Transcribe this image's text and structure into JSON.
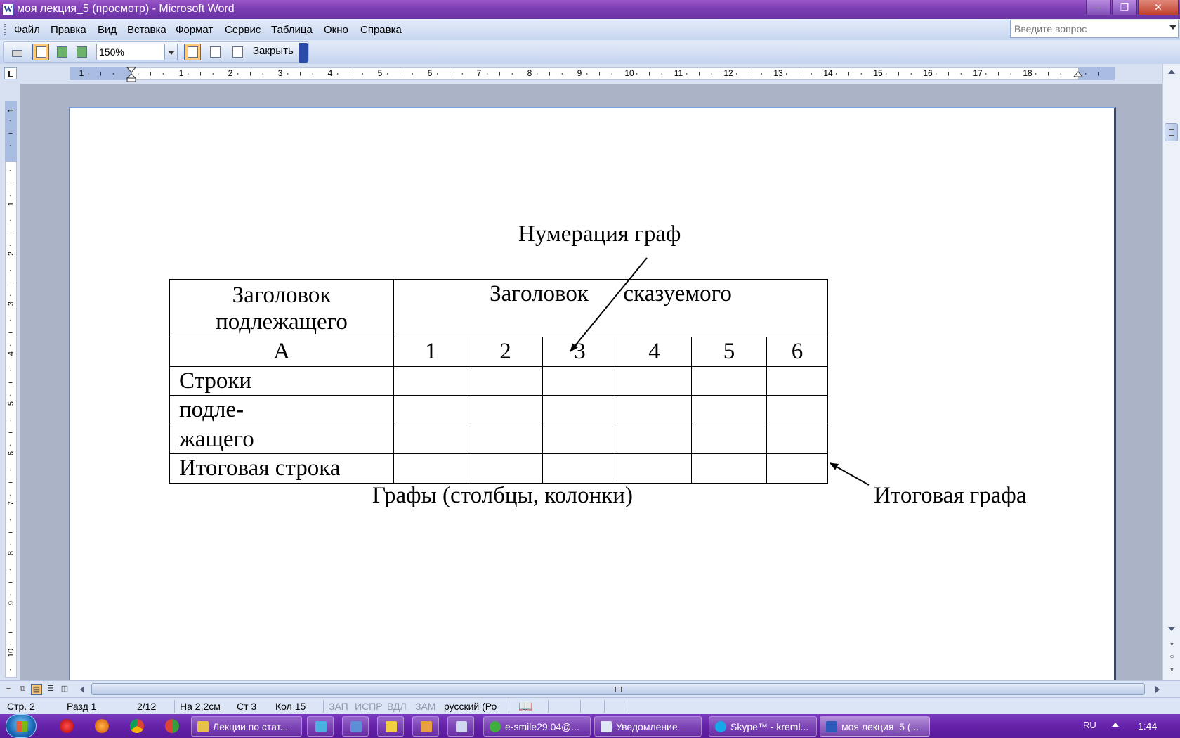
{
  "window": {
    "title": "моя лекция_5 (просмотр) - Microsoft Word",
    "minimize": "–",
    "restore": "❐",
    "close": "✕"
  },
  "menu": {
    "items": [
      "Файл",
      "Правка",
      "Вид",
      "Вставка",
      "Формат",
      "Сервис",
      "Таблица",
      "Окно",
      "Справка"
    ],
    "help_placeholder": "Введите вопрос"
  },
  "toolbar": {
    "zoom_value": "150%",
    "close_label": "Закрыть"
  },
  "ruler": {
    "h_numbers": [
      "1",
      "1",
      "2",
      "3",
      "4",
      "5",
      "6",
      "7",
      "8",
      "9",
      "10",
      "11",
      "12",
      "13",
      "14",
      "15",
      "16",
      "17",
      "18"
    ],
    "v_numbers": [
      "1",
      "1",
      "2",
      "3",
      "4",
      "5",
      "6",
      "7",
      "8",
      "9",
      "10"
    ]
  },
  "figure": {
    "numbering_label": "Нумерация граф",
    "columns_label": "Графы (столбцы, колонки)",
    "total_column_label": "Итоговая графа",
    "table": {
      "subject_header": "Заголовок подлежащего",
      "predicate_header": "Заголовок      сказуемого",
      "col_numbers": [
        "А",
        "1",
        "2",
        "3",
        "4",
        "5",
        "6"
      ],
      "rows": [
        "Строки",
        "подле-",
        "жащего",
        "Итоговая строка"
      ]
    }
  },
  "scrollbars": {
    "browse_prev": "⭑",
    "browse_select": "○",
    "browse_next": "⭑"
  },
  "statusbar": {
    "page": "Стр. 2",
    "section": "Разд 1",
    "pages": "2/12",
    "at": "На 2,2см",
    "line": "Ст 3",
    "col": "Кол 15",
    "rec": "ЗАП",
    "trk": "ИСПР",
    "ext": "ВДЛ",
    "ovr": "ЗАМ",
    "language": "русский (Ро"
  },
  "taskbar": {
    "buttons": [
      "Лекции по стат...",
      "e-smile29.04@...",
      "Уведомление",
      "Skype™ - kreml...",
      "моя лекция_5 (..."
    ],
    "language": "RU",
    "time": "1:44"
  },
  "colors": {
    "title_bar": "#7c3fb3",
    "taskbar": "#6422a8",
    "doc_background": "#abb3c6",
    "page": "#ffffff"
  }
}
